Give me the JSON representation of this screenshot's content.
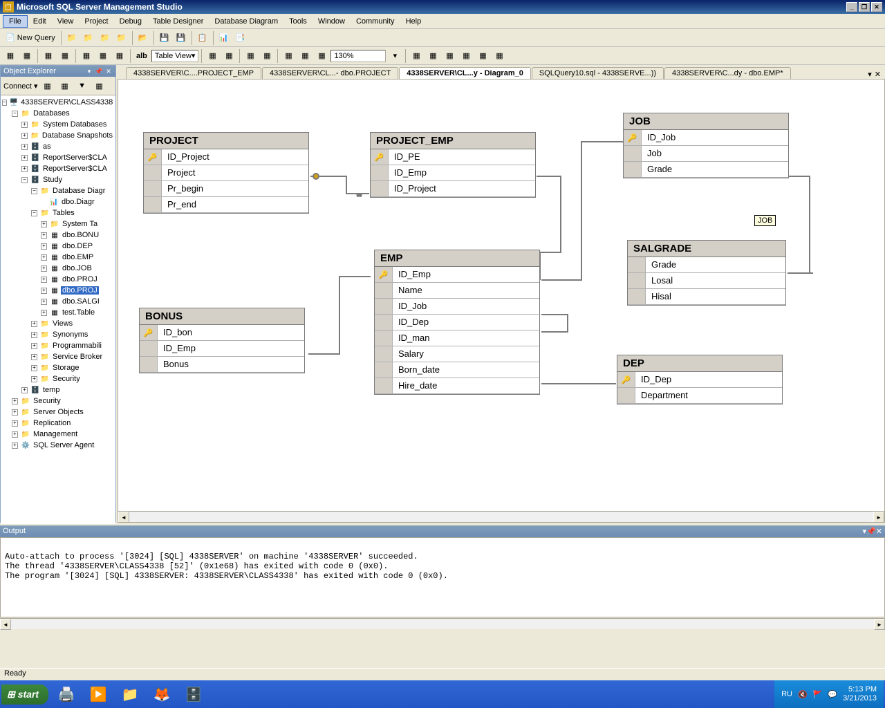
{
  "app_title": "Microsoft SQL Server Management Studio",
  "menus": [
    "File",
    "Edit",
    "View",
    "Project",
    "Debug",
    "Table Designer",
    "Database Diagram",
    "Tools",
    "Window",
    "Community",
    "Help"
  ],
  "toolbar1": {
    "new_query": "New Query",
    "table_view": "Table View",
    "zoom": "130%"
  },
  "object_explorer": {
    "title": "Object Explorer",
    "connect": "Connect",
    "server": "4338SERVER\\CLASS4338",
    "databases": "Databases",
    "nodes": {
      "sysdb": "System Databases",
      "snapshots": "Database Snapshots",
      "as": "as",
      "reportserver1": "ReportServer$CLA",
      "reportserver2": "ReportServer$CLA",
      "study": "Study",
      "diagrams": "Database Diagr",
      "diagram1": "dbo.Diagr",
      "tables": "Tables",
      "systables": "System Ta",
      "tbl_bonus": "dbo.BONU",
      "tbl_dep": "dbo.DEP",
      "tbl_emp": "dbo.EMP",
      "tbl_job": "dbo.JOB",
      "tbl_proj1": "dbo.PROJ",
      "tbl_proj2": "dbo.PROJ",
      "tbl_salg": "dbo.SALGI",
      "tbl_test": "test.Table",
      "views": "Views",
      "synonyms": "Synonyms",
      "prog": "Programmabili",
      "broker": "Service Broker",
      "storage": "Storage",
      "security_db": "Security",
      "temp": "temp",
      "security": "Security",
      "server_objects": "Server Objects",
      "replication": "Replication",
      "management": "Management",
      "agent": "SQL Server Agent"
    }
  },
  "tabs": [
    "4338SERVER\\C....PROJECT_EMP",
    "4338SERVER\\CL...- dbo.PROJECT",
    "4338SERVER\\CL...y - Diagram_0",
    "SQLQuery10.sql - 4338SERVE...))",
    "4338SERVER\\C...dy - dbo.EMP*"
  ],
  "active_tab": 2,
  "diagram": {
    "tables": {
      "PROJECT": {
        "title": "PROJECT",
        "cols": [
          {
            "k": true,
            "n": "ID_Project"
          },
          {
            "k": false,
            "n": "Project"
          },
          {
            "k": false,
            "n": "Pr_begin"
          },
          {
            "k": false,
            "n": "Pr_end"
          }
        ]
      },
      "PROJECT_EMP": {
        "title": "PROJECT_EMP",
        "cols": [
          {
            "k": true,
            "n": "ID_PE"
          },
          {
            "k": false,
            "n": "ID_Emp"
          },
          {
            "k": false,
            "n": "ID_Project"
          }
        ]
      },
      "JOB": {
        "title": "JOB",
        "cols": [
          {
            "k": true,
            "n": "ID_Job"
          },
          {
            "k": false,
            "n": "Job"
          },
          {
            "k": false,
            "n": "Grade"
          }
        ]
      },
      "EMP": {
        "title": "EMP",
        "cols": [
          {
            "k": true,
            "n": "ID_Emp"
          },
          {
            "k": false,
            "n": "Name"
          },
          {
            "k": false,
            "n": "ID_Job"
          },
          {
            "k": false,
            "n": "ID_Dep"
          },
          {
            "k": false,
            "n": "ID_man"
          },
          {
            "k": false,
            "n": "Salary"
          },
          {
            "k": false,
            "n": "Born_date"
          },
          {
            "k": false,
            "n": "Hire_date"
          }
        ]
      },
      "SALGRADE": {
        "title": "SALGRADE",
        "cols": [
          {
            "k": false,
            "n": "Grade"
          },
          {
            "k": false,
            "n": "Losal"
          },
          {
            "k": false,
            "n": "Hisal"
          }
        ]
      },
      "BONUS": {
        "title": "BONUS",
        "cols": [
          {
            "k": true,
            "n": "ID_bon"
          },
          {
            "k": false,
            "n": "ID_Emp"
          },
          {
            "k": false,
            "n": "Bonus"
          }
        ]
      },
      "DEP": {
        "title": "DEP",
        "cols": [
          {
            "k": true,
            "n": "ID_Dep"
          },
          {
            "k": false,
            "n": "Department"
          }
        ]
      }
    },
    "tooltip": "JOB"
  },
  "output": {
    "title": "Output",
    "lines": [
      "",
      "Auto-attach to process '[3024] [SQL] 4338SERVER' on machine '4338SERVER' succeeded.",
      "The thread '4338SERVER\\CLASS4338 [52]' (0x1e68) has exited with code 0 (0x0).",
      "The program '[3024] [SQL] 4338SERVER: 4338SERVER\\CLASS4338' has exited with code 0 (0x0)."
    ]
  },
  "status": "Ready",
  "taskbar": {
    "start": "start",
    "lang": "RU",
    "time": "5:13 PM",
    "date": "3/21/2013"
  }
}
